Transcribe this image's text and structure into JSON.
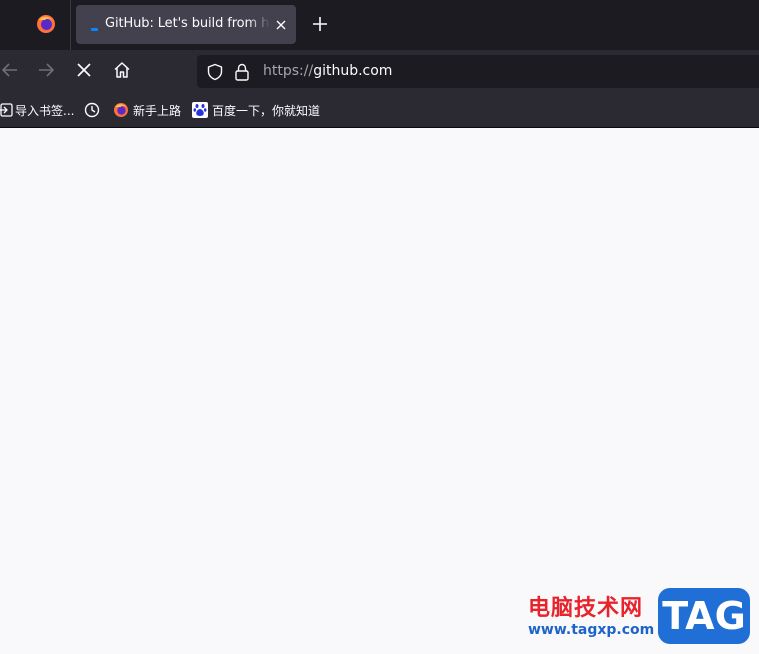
{
  "tabs": [
    {
      "title": "GitHub: Let's build from here",
      "active": true
    }
  ],
  "nav": {
    "url_scheme": "https://",
    "url_host": "github.com",
    "loading": true
  },
  "bookmarks": [
    {
      "label": "导入书签...",
      "icon": "import-icon"
    },
    {
      "label": "",
      "icon": "history-clock-icon"
    },
    {
      "label": "新手上路",
      "icon": "firefox-icon"
    },
    {
      "label": "百度一下，你就知道",
      "icon": "baidu-paw-icon"
    }
  ],
  "watermark": {
    "site_name": "电脑技术网",
    "url": "www.tagxp.com",
    "badge": "TAG"
  },
  "colors": {
    "tabstrip": "#1c1b22",
    "toolbar": "#2b2a33",
    "active_tab": "#42414d",
    "content_bg": "#f9f9fb",
    "watermark_red": "#e8242b",
    "watermark_blue": "#1f6fd6"
  }
}
